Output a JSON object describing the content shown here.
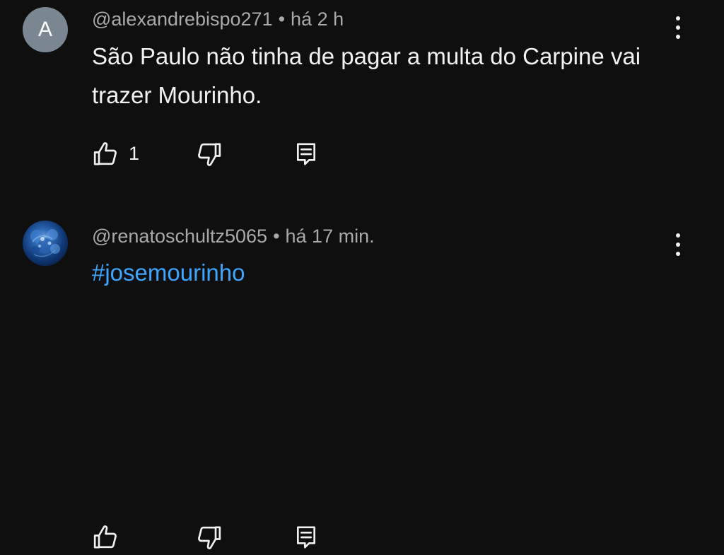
{
  "comments": [
    {
      "avatar_letter": "A",
      "username": "@alexandrebispo271",
      "separator": "•",
      "time": "há 2 h",
      "text": "São Paulo não tinha de pagar a multa do  Carpine vai trazer Mourinho.",
      "like_count": "1",
      "icons": {
        "like": "thumbs-up-icon",
        "dislike": "thumbs-down-icon",
        "reply": "reply-icon",
        "more": "more-vert-icon"
      }
    },
    {
      "avatar_desc": "blue-avatar-image",
      "username": "@renatoschultz5065",
      "separator": "•",
      "time": "há 17 min.",
      "text": "#josemourinho",
      "icons": {
        "like": "thumbs-up-icon",
        "dislike": "thumbs-down-icon",
        "reply": "reply-icon",
        "more": "more-vert-icon"
      }
    }
  ],
  "colors": {
    "background": "#0f0f0f",
    "meta_text": "#aaaaaa",
    "body_text": "#f1f1f1",
    "hashtag": "#3ea6ff",
    "avatar_letter_bg": "#7a8792"
  }
}
